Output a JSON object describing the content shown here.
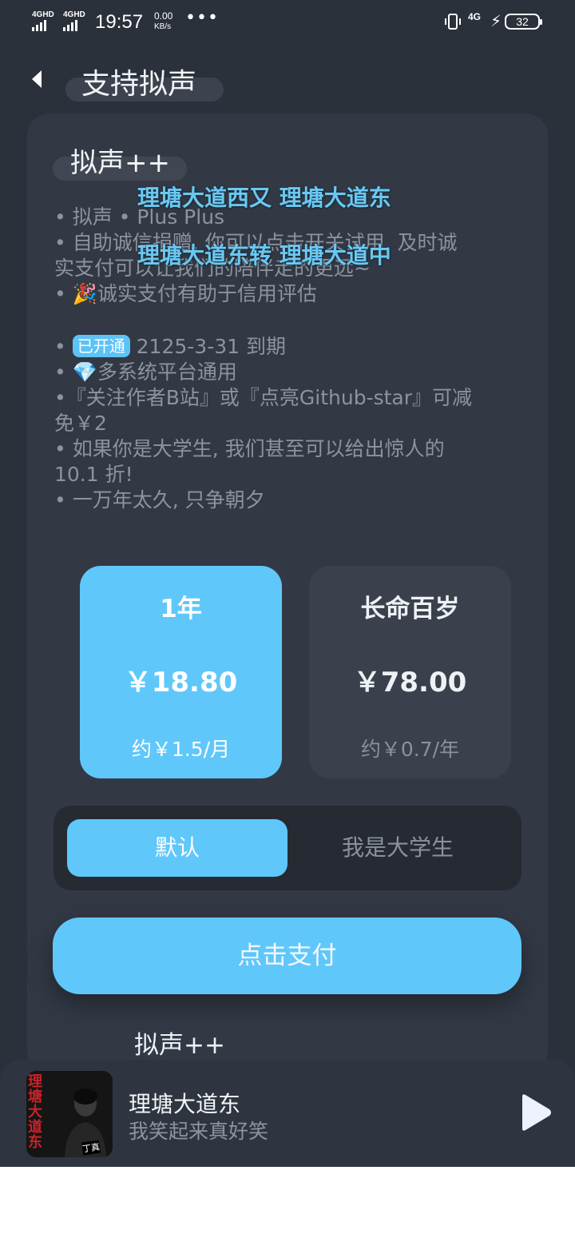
{
  "status_bar": {
    "signal1": "4GHD",
    "signal2": "4GHD",
    "time": "19:57",
    "speed_value": "0.00",
    "speed_unit": "KB/s",
    "more": "•••",
    "network": "4G",
    "battery": "32"
  },
  "header": {
    "back_icon": "chevron-left-icon",
    "title": "支持拟声"
  },
  "product": {
    "name": "拟声++"
  },
  "description": {
    "line1": "• 拟声 • Plus Plus",
    "line2": "• 自助诚信捐赠, 你可以点击开关试用, 及时诚",
    "line3": "实支付可以让我们的陪伴走的更远~",
    "line4_icon": "🎉",
    "line4": "诚实支付有助于信用评估",
    "badge": "已开通",
    "expiry": "2125-3-31 到期",
    "line6_icon": "💎",
    "line6": "多系统平台通用",
    "line7": "•『关注作者B站』或『点亮Github-star』可减",
    "line8": "免￥2",
    "line9": "• 如果你是大学生, 我们甚至可以给出惊人的",
    "line10": "10.1 折!",
    "line11": "• 一万年太久, 只争朝夕"
  },
  "lyrics_overlay": {
    "line1": "理塘大道西又 理塘大道东",
    "line2": "理塘大道东转 理塘大道中"
  },
  "plans": [
    {
      "title": "1年",
      "price": "￥18.80",
      "note": "约￥1.5/月",
      "selected": true
    },
    {
      "title": "长命百岁",
      "price": "￥78.00",
      "note": "约￥0.7/年",
      "selected": false
    }
  ],
  "segment": {
    "option_default": "默认",
    "option_student": "我是大学生",
    "selected": "默认"
  },
  "pay_button": "点击支付",
  "footer_product": "拟声++",
  "player": {
    "cover_text": "理塘大道东",
    "cover_caption": "丁真",
    "song": "理塘大道东",
    "artist": "我笑起来真好笑",
    "play_icon": "play-icon"
  },
  "colors": {
    "accent": "#60c7fa",
    "background": "#2b313b",
    "card": "#323945"
  }
}
